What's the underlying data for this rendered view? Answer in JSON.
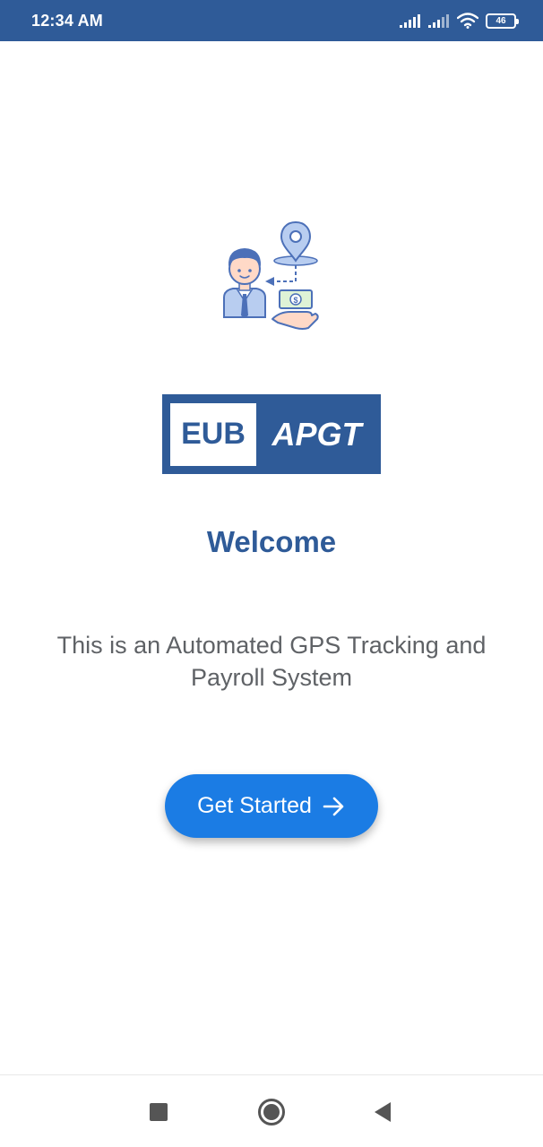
{
  "status_bar": {
    "time": "12:34 AM",
    "battery_level": "46",
    "icons": [
      "signal-icon",
      "signal-icon",
      "wifi-icon",
      "battery-icon"
    ]
  },
  "welcome_screen": {
    "logo": {
      "left_text": "EUB",
      "right_text": "APGT"
    },
    "title": "Welcome",
    "description": "This is an Automated GPS Tracking and Payroll System",
    "cta": {
      "label": "Get Started",
      "icon": "arrow-right-icon"
    }
  },
  "nav_bar": {
    "buttons": [
      "recent-apps-icon",
      "home-icon",
      "back-icon"
    ]
  },
  "colors": {
    "brand": "#2f5b98",
    "button": "#1b7ce4",
    "description_text": "#5f6266"
  }
}
